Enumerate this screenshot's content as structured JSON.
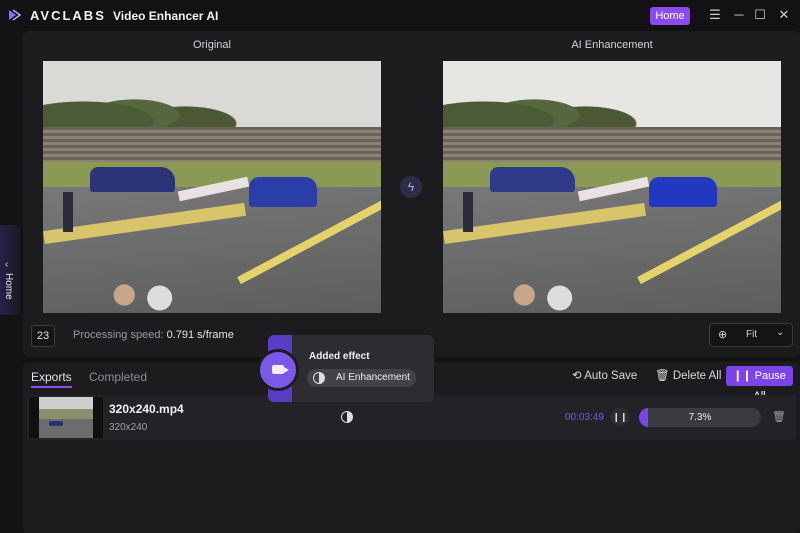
{
  "titlebar": {
    "brand": "AVCLABS",
    "product": "Video Enhancer AI",
    "home_button": "Home",
    "menu_icon": "menu-icon",
    "minimize_icon": "minimize-icon",
    "maximize_icon": "maximize-icon",
    "close_icon": "close-icon"
  },
  "side_tab": {
    "label": "Home"
  },
  "preview": {
    "original_label": "Original",
    "enhanced_label": "AI Enhancement",
    "frame_number": "23",
    "speed_label": "Processing speed:",
    "speed_value": "0.791 s/frame",
    "zoom_value": "Fit"
  },
  "tasks": {
    "tabs": [
      {
        "label": "Exports",
        "active": true
      },
      {
        "label": "Completed",
        "active": false
      }
    ],
    "auto_save": "Auto Save",
    "delete_all": "Delete All",
    "pause_all": "Pause All",
    "rows": [
      {
        "file_name": "320x240.mp4",
        "resolution": "320x240",
        "elapsed": "00:03:49",
        "progress_pct": "7.3%",
        "progress_fraction": 0.073
      }
    ]
  },
  "popup": {
    "title": "Added effect",
    "effect": "AI Enhancement"
  },
  "colors": {
    "accent": "#8a4cf0",
    "background": "#141416",
    "panel": "#1c1c1f"
  }
}
